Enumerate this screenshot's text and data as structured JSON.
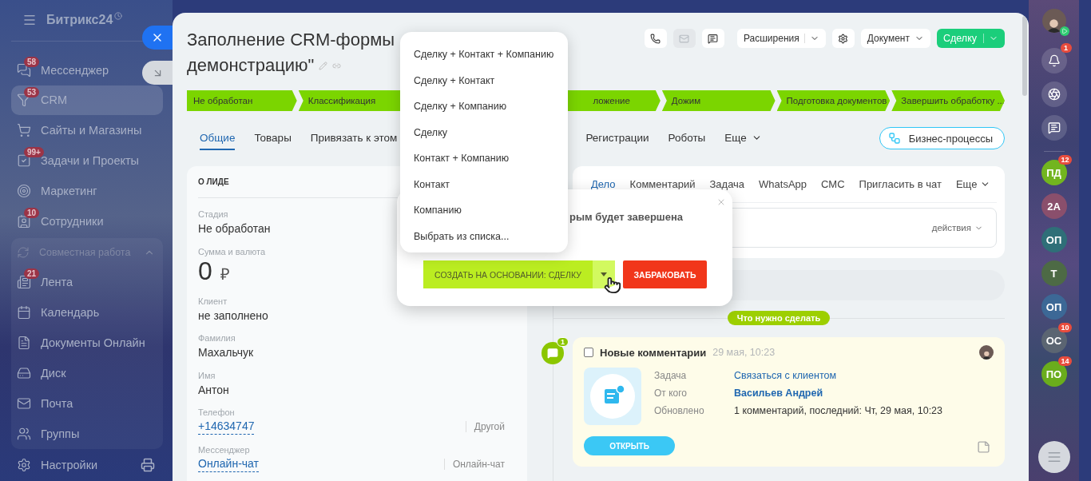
{
  "sidebar": {
    "logo": "Битрикс24",
    "items": [
      {
        "label": "Мессенджер",
        "badge": "58",
        "selected": false
      },
      {
        "label": "CRM",
        "badge": "53",
        "selected": true
      },
      {
        "label": "Сайты и Магазины",
        "selected": false
      },
      {
        "label": "Задачи и Проекты",
        "badge": "99+",
        "selected": false
      },
      {
        "label": "Маркетинг",
        "selected": false
      },
      {
        "label": "Сотрудники",
        "badge": "10",
        "selected": false
      },
      {
        "label": "Совместная работа",
        "expanded": true,
        "children": [
          {
            "label": "Лента",
            "badge": "21",
            "selected": false
          },
          {
            "label": "Календарь",
            "selected": false
          },
          {
            "label": "Документы Онлайн",
            "selected": false
          },
          {
            "label": "Диск",
            "selected": false
          },
          {
            "label": "Почта",
            "selected": false
          },
          {
            "label": "Группы",
            "selected": false
          }
        ]
      }
    ],
    "settings": "Настройки"
  },
  "card": {
    "title_lines": [
      "Заполнение CRM-формы",
      "демонстрацию\""
    ],
    "icon_buttons": [
      {
        "disabled": false
      },
      {
        "disabled": true
      },
      {
        "disabled": false
      }
    ],
    "extensions_button": "Расширения",
    "document_button": "Документ",
    "create_button": "Сделку",
    "stages": [
      {
        "label": "Не обработан"
      },
      {
        "label": "Классификация"
      },
      {
        "label": "ложение",
        "clipped": true
      },
      {
        "label": "Дожим"
      },
      {
        "label": "Подготовка документов"
      },
      {
        "label": "Завершить обработку ..."
      }
    ],
    "tabs": [
      {
        "label": "Общие",
        "selected": true
      },
      {
        "label": "Товары",
        "selected": false
      },
      {
        "label": "Привязать к этом",
        "selected": false
      },
      {
        "label": "Регистрации",
        "selected": false,
        "after_gap": true
      },
      {
        "label": "Роботы",
        "selected": false
      },
      {
        "label": "Еще",
        "selected": false,
        "menu": true
      }
    ],
    "bp_button": "Бизнес-процессы"
  },
  "lead": {
    "title": "О ЛИДЕ",
    "fields": [
      {
        "kind": "text",
        "label": "Стадия",
        "value": "Не обработан"
      },
      {
        "kind": "money",
        "label": "Сумма и валюта",
        "value": "0",
        "currency": "₽"
      },
      {
        "kind": "text",
        "label": "Клиент",
        "value": "не заполнено"
      },
      {
        "kind": "text",
        "label": "Фамилия",
        "value": "Махальчук"
      },
      {
        "kind": "text",
        "label": "Имя",
        "value": "Антон"
      },
      {
        "kind": "link",
        "label": "Телефон",
        "value": "+14634747",
        "type_label": "Другой"
      },
      {
        "kind": "link",
        "label": "Мессенджер",
        "value": "Онлайн-чат",
        "type_label": "Онлайн-чат"
      }
    ]
  },
  "timeline": {
    "tabs": [
      {
        "label": "Дело",
        "selected": true
      },
      {
        "label": "Комментарий",
        "selected": false
      },
      {
        "label": "Задача",
        "selected": false
      },
      {
        "label": "WhatsApp",
        "selected": false
      },
      {
        "label": "СМС",
        "selected": false
      },
      {
        "label": "Пригласить в чат",
        "selected": false
      },
      {
        "label": "Еще",
        "selected": false,
        "menu": true
      }
    ],
    "actions": "действия",
    "section_badge": "Что нужно сделать",
    "activity": {
      "checked": false,
      "title": "Новые комментарии",
      "time": "29 мая, 10:23",
      "comment_badge": "1",
      "rows": [
        {
          "kind": "link",
          "label": "Задача",
          "value": "Связаться с клиентом"
        },
        {
          "kind": "person",
          "label": "От кого",
          "value": "Васильев Андрей"
        },
        {
          "kind": "text",
          "label": "Обновлено",
          "value": "1 комментарий, последний: Чт, 29 мая, 10:23"
        }
      ],
      "open_button": "ОТКРЫТЬ"
    }
  },
  "dialog": {
    "text": "рым будет завершена",
    "convert_button": "СОЗДАТЬ НА ОСНОВАНИИ: СДЕЛКУ",
    "reject_button": "ЗАБРАКОВАТЬ"
  },
  "menu": {
    "items": [
      {
        "label": "Сделку + Контакт + Компанию"
      },
      {
        "label": "Сделку + Контакт"
      },
      {
        "label": "Сделку + Компанию"
      },
      {
        "label": "Сделку"
      },
      {
        "label": "Контакт + Компанию"
      },
      {
        "label": "Контакт"
      },
      {
        "label": "Компанию"
      },
      {
        "label": "Выбрать из списка..."
      }
    ]
  },
  "right_rail": {
    "notifications_badge": "1",
    "chats": [
      {
        "kind": "photo"
      },
      {
        "kind": "initials",
        "initials": "ПД",
        "color": "#72b51f",
        "badge": "12"
      },
      {
        "kind": "initials",
        "initials": "2А",
        "color": "#8a4f6c"
      },
      {
        "kind": "initials",
        "initials": "ОП",
        "color": "#2f6f78"
      },
      {
        "kind": "initials",
        "initials": "Т",
        "color": "#4d6a45"
      },
      {
        "kind": "initials",
        "initials": "ОП",
        "color": "#3c6896"
      },
      {
        "kind": "initials",
        "initials": "ОС",
        "color": "#5b6572",
        "badge": "10"
      },
      {
        "kind": "initials",
        "initials": "ПО",
        "color": "#6aad1c",
        "badge": "14"
      }
    ]
  }
}
